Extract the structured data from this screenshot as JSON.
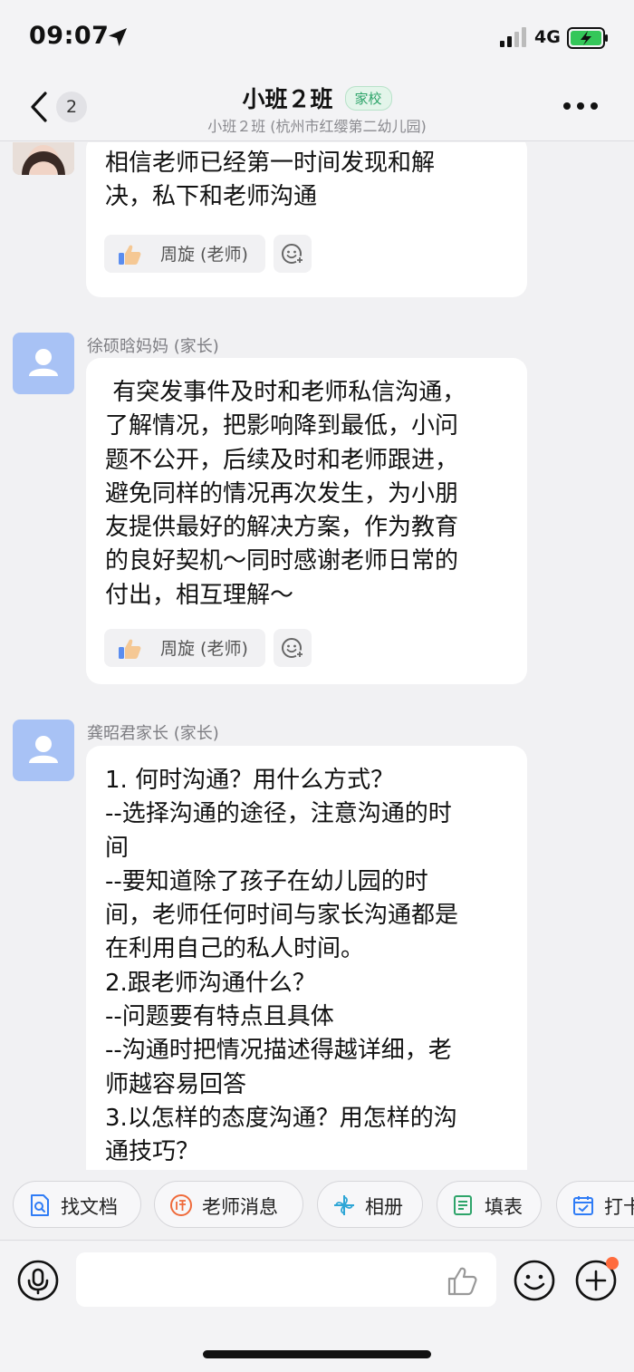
{
  "status_bar": {
    "time": "09:07",
    "network": "4G"
  },
  "header": {
    "back_badge": "2",
    "title": "小班２班",
    "tag": "家校",
    "subtitle": "小班２班 (杭州市红缨第二幼儿园)"
  },
  "messages": [
    {
      "text": "相信老师已经第一时间发现和解\n决，私下和老师沟通",
      "liked_by": "周旋 (老师)"
    },
    {
      "sender": "徐硕晗妈妈 (家长)",
      "text": " 有突发事件及时和老师私信沟通，\n了解情况，把影响降到最低，小问\n题不公开，后续及时和老师跟进，\n避免同样的情况再次发生，为小朋\n友提供最好的解决方案，作为教育\n的良好契机～同时感谢老师日常的\n付出，相互理解～",
      "liked_by": "周旋 (老师)"
    },
    {
      "sender": "龚昭君家长 (家长)",
      "text": "1. 何时沟通？用什么方式？\n--选择沟通的途径，注意沟通的时\n间\n--要知道除了孩子在幼儿园的时\n间，老师任何时间与家长沟通都是\n在利用自己的私人时间。\n2.跟老师沟通什么？\n--问题要有特点且具体\n--沟通时把情况描述得越详细，老\n师越容易回答\n3.以怎样的态度沟通？用怎样的沟\n通技巧？"
    }
  ],
  "quick_actions": [
    "找文档",
    "老师消息",
    "相册",
    "填表",
    "打卡"
  ],
  "input": {
    "placeholder": ""
  },
  "colors": {
    "accent_green": "#2ea46a",
    "avatar_blue": "#a8c2f5",
    "notification_dot": "#ff6b3d"
  }
}
